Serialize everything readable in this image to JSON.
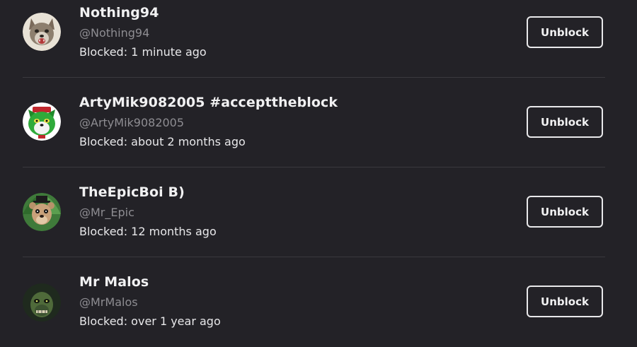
{
  "blocked_users": [
    {
      "display_name": "Nothing94",
      "handle": "@Nothing94",
      "blocked_text": "Blocked: 1 minute ago",
      "button_label": "Unblock",
      "avatar_icon": "wolf-avatar-icon"
    },
    {
      "display_name": "ArtyMik9082005 #accepttheblock",
      "handle": "@ArtyMik9082005",
      "blocked_text": "Blocked: about 2 months ago",
      "button_label": "Unblock",
      "avatar_icon": "green-cat-avatar-icon"
    },
    {
      "display_name": "TheEpicBoi B)",
      "handle": "@Mr_Epic",
      "blocked_text": "Blocked: 12 months ago",
      "button_label": "Unblock",
      "avatar_icon": "animatronic-avatar-icon"
    },
    {
      "display_name": "Mr Malos",
      "handle": "@MrMalos",
      "blocked_text": "Blocked: over 1 year ago",
      "button_label": "Unblock",
      "avatar_icon": "springtrap-avatar-icon"
    }
  ],
  "colors": {
    "background": "#232227",
    "text_primary": "#f1f1f2",
    "text_secondary": "#8e8d92",
    "divider": "#3a393e"
  }
}
